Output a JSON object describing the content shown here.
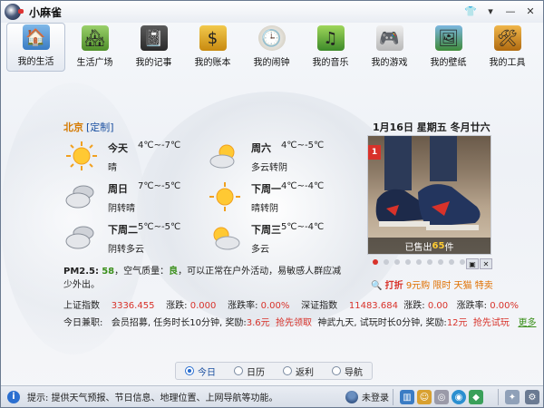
{
  "app": {
    "title": "小麻雀"
  },
  "toolbar": [
    {
      "label": "我的生活",
      "icon": "house-icon",
      "active": true
    },
    {
      "label": "生活广场",
      "icon": "village-icon",
      "active": false
    },
    {
      "label": "我的记事",
      "icon": "notebook-icon",
      "active": false
    },
    {
      "label": "我的账本",
      "icon": "ledger-icon",
      "active": false
    },
    {
      "label": "我的闹钟",
      "icon": "clock-icon",
      "active": false
    },
    {
      "label": "我的音乐",
      "icon": "music-icon",
      "active": false
    },
    {
      "label": "我的游戏",
      "icon": "gamepad-icon",
      "active": false
    },
    {
      "label": "我的壁纸",
      "icon": "wallpaper-icon",
      "active": false
    },
    {
      "label": "我的工具",
      "icon": "tools-icon",
      "active": false
    }
  ],
  "weather": {
    "city": "北京",
    "customize": "[定制]",
    "days": [
      {
        "day": "今天",
        "temp": "4℃~-7℃",
        "cond": "晴",
        "icon": "sun-icon"
      },
      {
        "day": "周六",
        "temp": "4℃~-5℃",
        "cond": "多云转阴",
        "icon": "cloudy-icon"
      },
      {
        "day": "周日",
        "temp": "7℃~-5℃",
        "cond": "阴转晴",
        "icon": "overcast-sun-icon"
      },
      {
        "day": "下周一",
        "temp": "4℃~-4℃",
        "cond": "晴转阴",
        "icon": "sun-cloud-icon"
      },
      {
        "day": "下周二",
        "temp": "5℃~-5℃",
        "cond": "阴转多云",
        "icon": "overcast-icon"
      },
      {
        "day": "下周三",
        "temp": "5℃~-4℃",
        "cond": "多云",
        "icon": "partly-cloudy-icon"
      }
    ]
  },
  "pm": {
    "label": "PM2.5:",
    "value": "58",
    "mid": "，空气质量：",
    "quality": "良",
    "advice": "，可以正常在户外活动，易敏感人群应减少外出。"
  },
  "calendar": {
    "date": "1月16日  星期五  冬月廿六"
  },
  "ad": {
    "badge": "1",
    "sold_prefix": "已售出",
    "sold_count": "65",
    "sold_suffix": "件",
    "slides": 10,
    "current": 0
  },
  "promo": {
    "hot": "打折",
    "text": " 9元购 限时 天猫 特卖"
  },
  "stocks": {
    "sh_label": "上证指数",
    "sh_value": "3336.455",
    "sh_chg_label": "涨跌:",
    "sh_chg": "0.000",
    "sh_pct_label": "涨跌率:",
    "sh_pct": "0.00%",
    "sz_label": "深证指数",
    "sz_value": "11483.684",
    "sz_chg_label": "涨跌:",
    "sz_chg": "0.00",
    "sz_pct_label": "涨跌率:",
    "sz_pct": "0.00%"
  },
  "earn": {
    "label": "今日兼职:",
    "task": "会员招募, 任务时长10分钟, 奖励:",
    "reward": "3.6元",
    "grab": "抢先领取",
    "task2": "神武九天, 试玩时长0分钟, 奖励:",
    "reward2": "12元",
    "grab2": "抢先试玩",
    "more": "更多"
  },
  "tabs": [
    {
      "label": "今日",
      "active": true
    },
    {
      "label": "日历",
      "active": false
    },
    {
      "label": "返利",
      "active": false
    },
    {
      "label": "导航",
      "active": false
    }
  ],
  "status": {
    "tip": "提示: 提供天气预报、节日信息、地理位置、上网导航等功能。",
    "login": "未登录"
  },
  "colors": {
    "accent": "#d57a00",
    "link": "#1a4fa0",
    "red": "#d8322a",
    "green": "#3a8f1a"
  }
}
